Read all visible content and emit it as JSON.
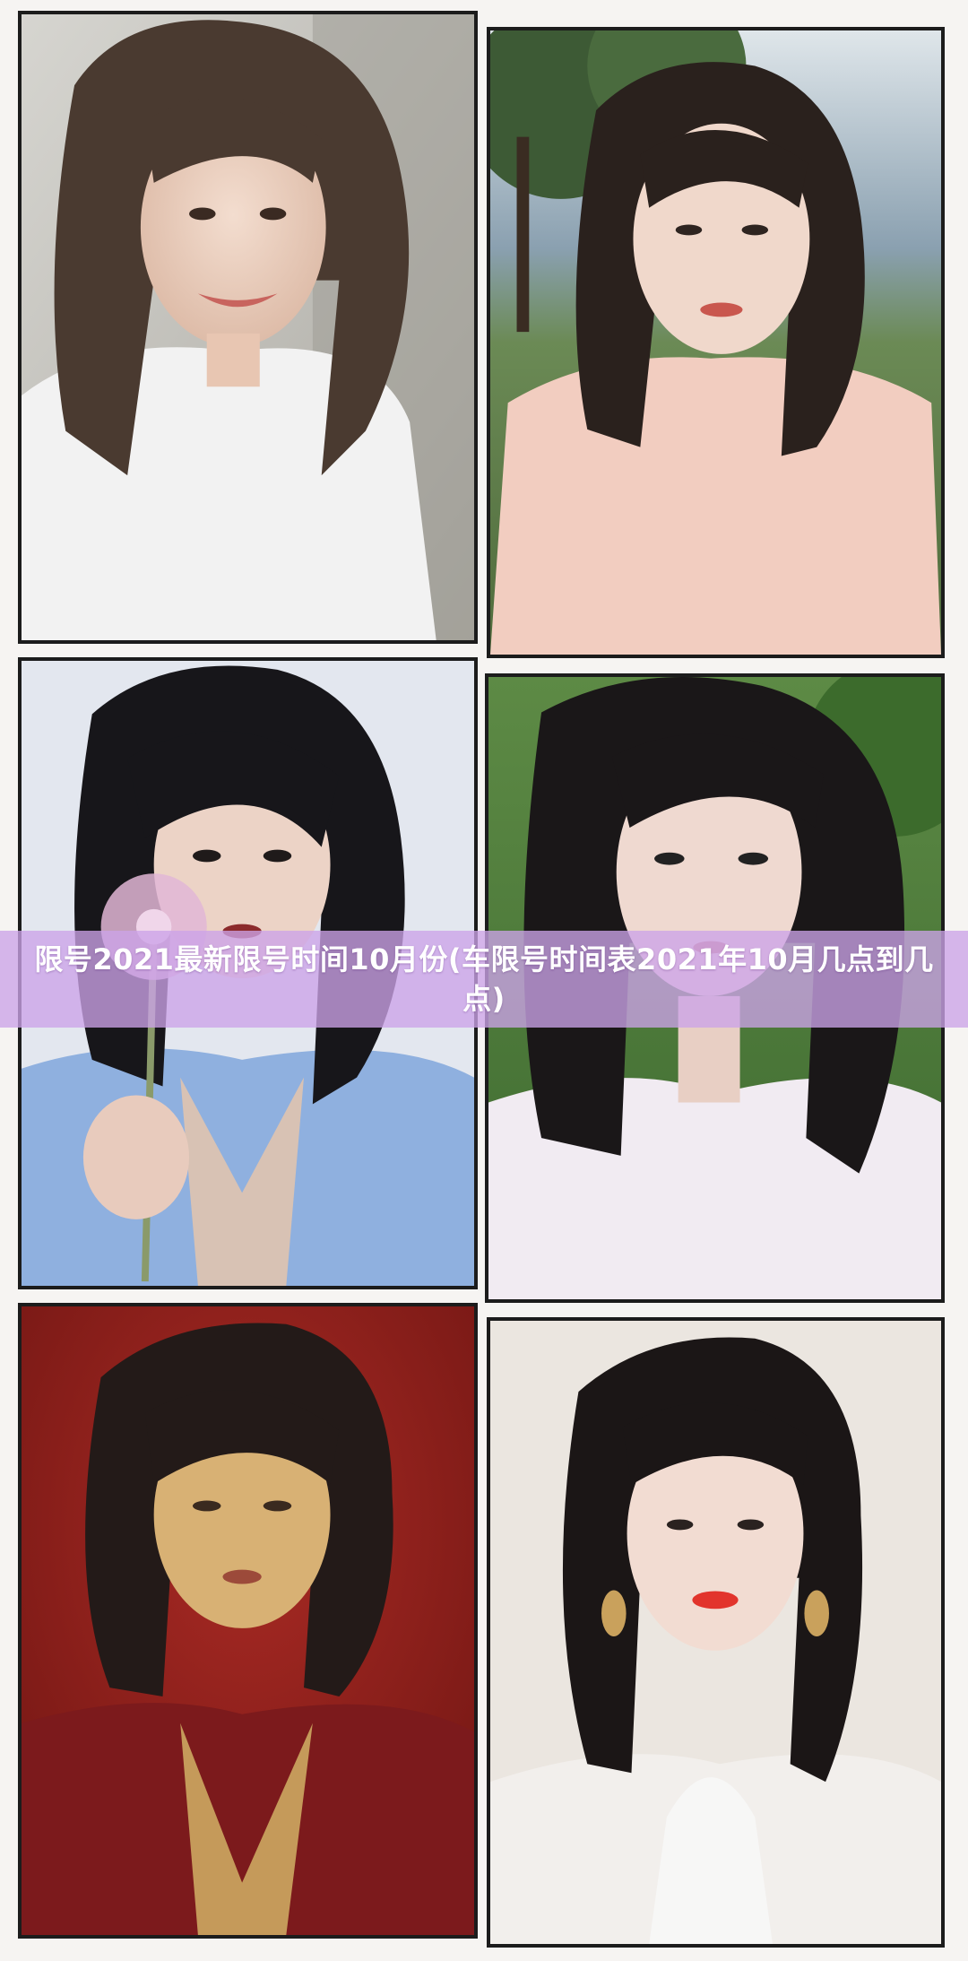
{
  "article": {
    "title": "限号2021最新限号时间10月份(车限号时间表2021年10月几点到几点)"
  },
  "colors": {
    "banner": "#cca3e8",
    "frame": "#1c1c1c",
    "background": "#f6f4f2"
  },
  "photos": [
    {
      "name": "portrait-white-tee-smiling",
      "backdrop": "#c9c8c3"
    },
    {
      "name": "portrait-pink-tee-outdoors",
      "backdrop": "#6e8a5e"
    },
    {
      "name": "portrait-blue-blazer-flower",
      "backdrop": "#e2e6ee"
    },
    {
      "name": "portrait-white-blouse-garden",
      "backdrop": "#4f7a3d"
    },
    {
      "name": "portrait-red-blazer-red-wall",
      "backdrop": "#8f1e1b"
    },
    {
      "name": "portrait-red-lips-earrings",
      "backdrop": "#e7e2dc"
    }
  ]
}
